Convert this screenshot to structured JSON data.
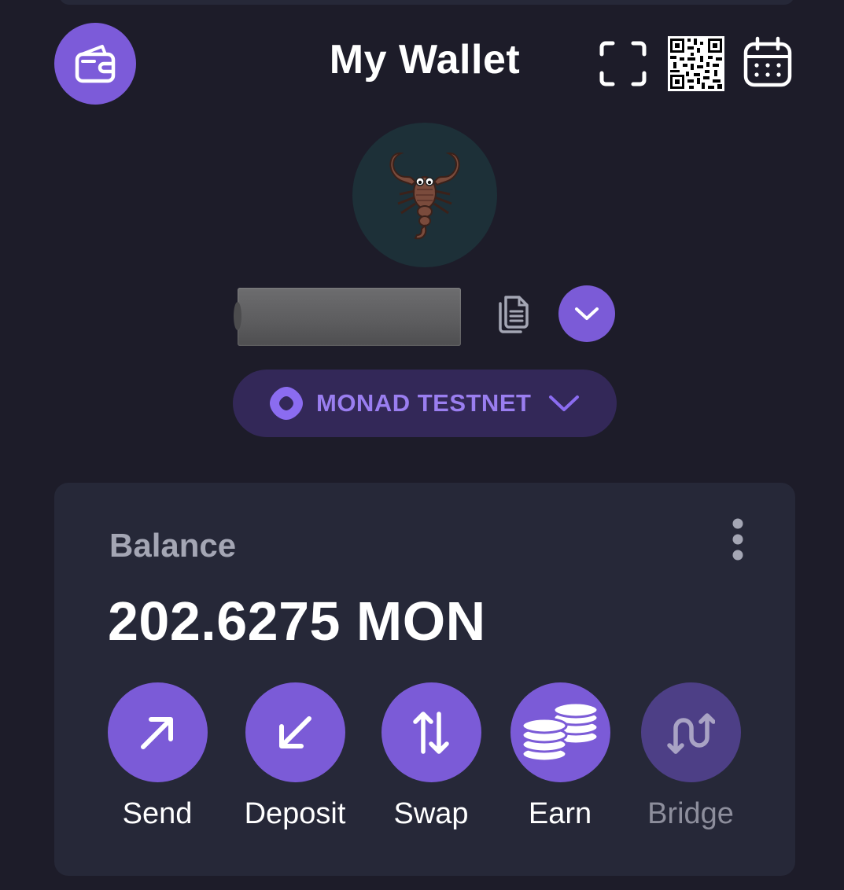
{
  "header": {
    "title": "My Wallet",
    "icons": [
      "wallet-icon",
      "scan-icon",
      "qr-code-icon",
      "calendar-icon"
    ]
  },
  "account": {
    "avatar_icon": "scorpion-emoji",
    "address_masked": "",
    "icons": [
      "copy-icon",
      "chevron-down-icon"
    ]
  },
  "network": {
    "name": "MONAD TESTNET",
    "icon": "monad-logo-icon"
  },
  "balance": {
    "label": "Balance",
    "amount": "202.6275 MON"
  },
  "actions": [
    {
      "label": "Send",
      "icon": "arrow-up-right-icon",
      "enabled": true
    },
    {
      "label": "Deposit",
      "icon": "arrow-down-left-icon",
      "enabled": true
    },
    {
      "label": "Swap",
      "icon": "swap-vertical-icon",
      "enabled": true
    },
    {
      "label": "Earn",
      "icon": "coins-stack-icon",
      "enabled": true
    },
    {
      "label": "Bridge",
      "icon": "bridge-icon",
      "enabled": false
    }
  ],
  "colors": {
    "background": "#1d1c29",
    "card": "#262838",
    "accent": "#7b5bd7",
    "accent_disabled": "#4d3f86",
    "network_pill": "#332858",
    "network_text": "#9a7ef0",
    "muted_text": "#a4a6b4"
  }
}
